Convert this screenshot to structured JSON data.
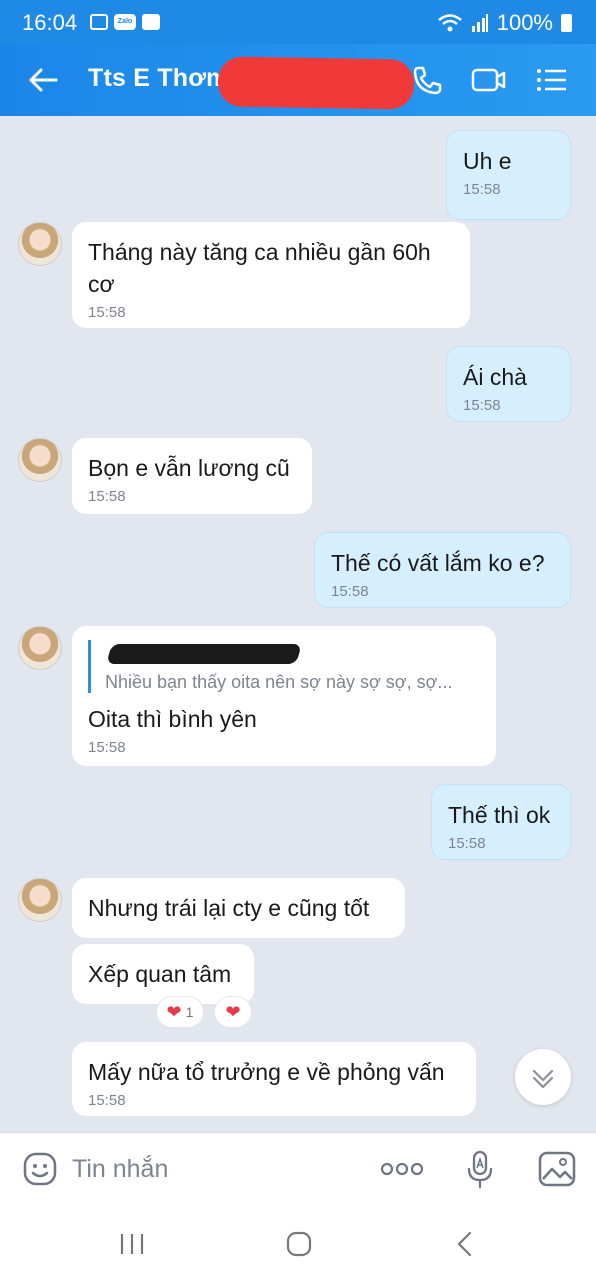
{
  "status_bar": {
    "time": "16:04",
    "battery": "100%",
    "zalo_badge": "Zalo"
  },
  "header": {
    "contact_name": "Tts E Thơm"
  },
  "messages": [
    {
      "side": "me",
      "text": "Uh e",
      "time": "15:58"
    },
    {
      "side": "them",
      "text": "Tháng này tăng ca nhiều gần 60h cơ",
      "time": "15:58"
    },
    {
      "side": "me",
      "text": "Ái chà",
      "time": "15:58"
    },
    {
      "side": "them",
      "text": "Bọn e vẫn lương cũ",
      "time": "15:58"
    },
    {
      "side": "me",
      "text": "Thế có vất lắm ko e?",
      "time": "15:58"
    },
    {
      "side": "them",
      "quote": "Nhiều bạn thấy oita nên sợ này sợ sợ, sợ...",
      "text": "Oita thì bình yên",
      "time": "15:58"
    },
    {
      "side": "me",
      "text": "Thế thì ok",
      "time": "15:58"
    },
    {
      "side": "them",
      "text": "Nhưng trái lại cty e cũng tốt"
    },
    {
      "side": "them",
      "text": "Xếp quan tâm",
      "reaction_count": "1"
    },
    {
      "side": "them",
      "text": "Mấy nữa tổ trưởng e về phỏng vấn",
      "time": "15:58"
    }
  ],
  "input": {
    "placeholder": "Tin nhắn"
  },
  "colors": {
    "header": "#1f8ae6",
    "my_bubble": "#d6efff",
    "their_bubble": "#ffffff",
    "background": "#e2e6ee",
    "heart": "#e53b4b"
  },
  "icons": [
    "back-arrow-icon",
    "phone-icon",
    "video-call-icon",
    "menu-icon",
    "emoji-icon",
    "more-icon",
    "mic-icon",
    "image-icon",
    "chevron-down-icon"
  ]
}
